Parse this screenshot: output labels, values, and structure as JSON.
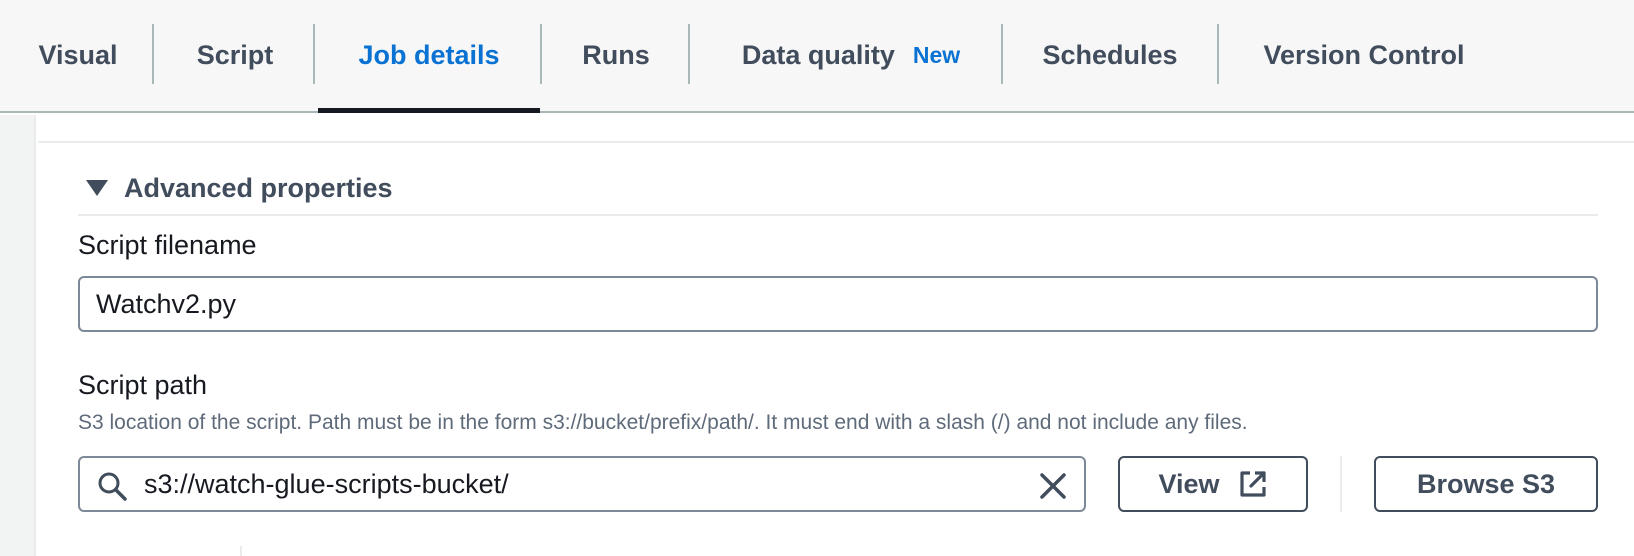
{
  "tabs": [
    {
      "label": "Visual"
    },
    {
      "label": "Script"
    },
    {
      "label": "Job details",
      "active": true
    },
    {
      "label": "Runs"
    },
    {
      "label": "Data quality",
      "badge": "New"
    },
    {
      "label": "Schedules"
    },
    {
      "label": "Version Control"
    }
  ],
  "accent_color": "#0972d3",
  "advanced": {
    "header": "Advanced properties",
    "expanded": true
  },
  "script_filename": {
    "label": "Script filename",
    "value": "Watchv2.py"
  },
  "script_path": {
    "label": "Script path",
    "description": "S3 location of the script. Path must be in the form s3://bucket/prefix/path/. It must end with a slash (/) and not include any files.",
    "value": "s3://watch-glue-scripts-bucket/",
    "view_button": "View",
    "browse_button": "Browse S3"
  },
  "icons": {
    "caret": "caret-down-icon",
    "search": "search-icon",
    "clear": "close-icon",
    "external": "external-link-icon"
  }
}
